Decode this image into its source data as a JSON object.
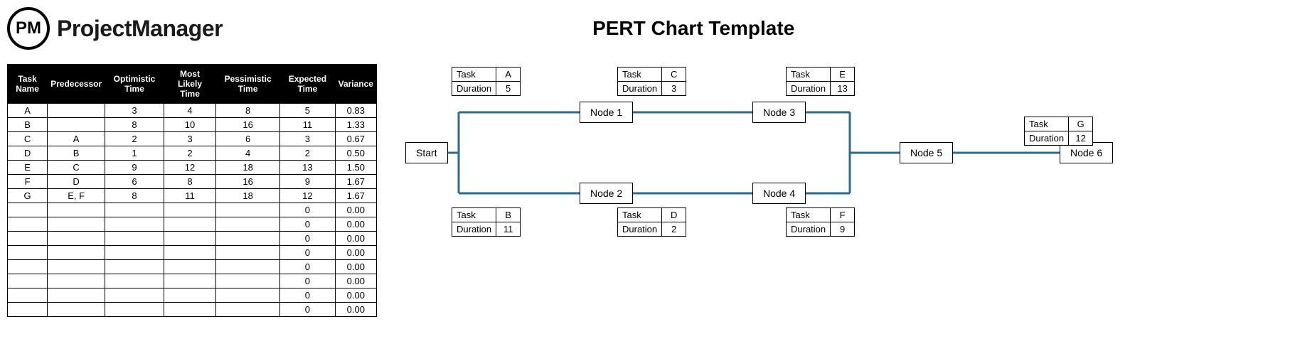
{
  "brand": {
    "logo_text": "PM",
    "name": "ProjectManager"
  },
  "chart_title": "PERT Chart Template",
  "table": {
    "headers": [
      "Task Name",
      "Predecessor",
      "Optimistic Time",
      "Most Likely Time",
      "Pessimistic Time",
      "Expected Time",
      "Variance"
    ],
    "rows": [
      [
        "A",
        "",
        "3",
        "4",
        "8",
        "5",
        "0.83"
      ],
      [
        "B",
        "",
        "8",
        "10",
        "16",
        "11",
        "1.33"
      ],
      [
        "C",
        "A",
        "2",
        "3",
        "6",
        "3",
        "0.67"
      ],
      [
        "D",
        "B",
        "1",
        "2",
        "4",
        "2",
        "0.50"
      ],
      [
        "E",
        "C",
        "9",
        "12",
        "18",
        "13",
        "1.50"
      ],
      [
        "F",
        "D",
        "6",
        "8",
        "16",
        "9",
        "1.67"
      ],
      [
        "G",
        "E, F",
        "8",
        "11",
        "18",
        "12",
        "1.67"
      ],
      [
        "",
        "",
        "",
        "",
        "",
        "0",
        "0.00"
      ],
      [
        "",
        "",
        "",
        "",
        "",
        "0",
        "0.00"
      ],
      [
        "",
        "",
        "",
        "",
        "",
        "0",
        "0.00"
      ],
      [
        "",
        "",
        "",
        "",
        "",
        "0",
        "0.00"
      ],
      [
        "",
        "",
        "",
        "",
        "",
        "0",
        "0.00"
      ],
      [
        "",
        "",
        "",
        "",
        "",
        "0",
        "0.00"
      ],
      [
        "",
        "",
        "",
        "",
        "",
        "0",
        "0.00"
      ],
      [
        "",
        "",
        "",
        "",
        "",
        "0",
        "0.00"
      ]
    ]
  },
  "nodes": {
    "start": "Start",
    "n1": "Node 1",
    "n2": "Node 2",
    "n3": "Node 3",
    "n4": "Node 4",
    "n5": "Node 5",
    "n6": "Node 6"
  },
  "labels": {
    "task": "Task",
    "duration": "Duration"
  },
  "info": {
    "a": {
      "task": "A",
      "duration": "5"
    },
    "b": {
      "task": "B",
      "duration": "11"
    },
    "c": {
      "task": "C",
      "duration": "3"
    },
    "d": {
      "task": "D",
      "duration": "2"
    },
    "e": {
      "task": "E",
      "duration": "13"
    },
    "f": {
      "task": "F",
      "duration": "9"
    },
    "g": {
      "task": "G",
      "duration": "12"
    }
  },
  "chart_data": {
    "type": "table",
    "title": "PERT Chart Template",
    "tasks": [
      {
        "name": "A",
        "predecessor": "",
        "optimistic": 3,
        "most_likely": 4,
        "pessimistic": 8,
        "expected": 5,
        "variance": 0.83
      },
      {
        "name": "B",
        "predecessor": "",
        "optimistic": 8,
        "most_likely": 10,
        "pessimistic": 16,
        "expected": 11,
        "variance": 1.33
      },
      {
        "name": "C",
        "predecessor": "A",
        "optimistic": 2,
        "most_likely": 3,
        "pessimistic": 6,
        "expected": 3,
        "variance": 0.67
      },
      {
        "name": "D",
        "predecessor": "B",
        "optimistic": 1,
        "most_likely": 2,
        "pessimistic": 4,
        "expected": 2,
        "variance": 0.5
      },
      {
        "name": "E",
        "predecessor": "C",
        "optimistic": 9,
        "most_likely": 12,
        "pessimistic": 18,
        "expected": 13,
        "variance": 1.5
      },
      {
        "name": "F",
        "predecessor": "D",
        "optimistic": 6,
        "most_likely": 8,
        "pessimistic": 16,
        "expected": 9,
        "variance": 1.67
      },
      {
        "name": "G",
        "predecessor": "E, F",
        "optimistic": 8,
        "most_likely": 11,
        "pessimistic": 18,
        "expected": 12,
        "variance": 1.67
      }
    ],
    "nodes": [
      "Start",
      "Node 1",
      "Node 2",
      "Node 3",
      "Node 4",
      "Node 5",
      "Node 6"
    ],
    "edges": [
      {
        "from": "Start",
        "to": "Node 1",
        "task": "A",
        "duration": 5
      },
      {
        "from": "Start",
        "to": "Node 2",
        "task": "B",
        "duration": 11
      },
      {
        "from": "Node 1",
        "to": "Node 3",
        "task": "C",
        "duration": 3
      },
      {
        "from": "Node 2",
        "to": "Node 4",
        "task": "D",
        "duration": 2
      },
      {
        "from": "Node 3",
        "to": "Node 5",
        "task": "E",
        "duration": 13
      },
      {
        "from": "Node 4",
        "to": "Node 5",
        "task": "F",
        "duration": 9
      },
      {
        "from": "Node 5",
        "to": "Node 6",
        "task": "G",
        "duration": 12
      }
    ]
  }
}
